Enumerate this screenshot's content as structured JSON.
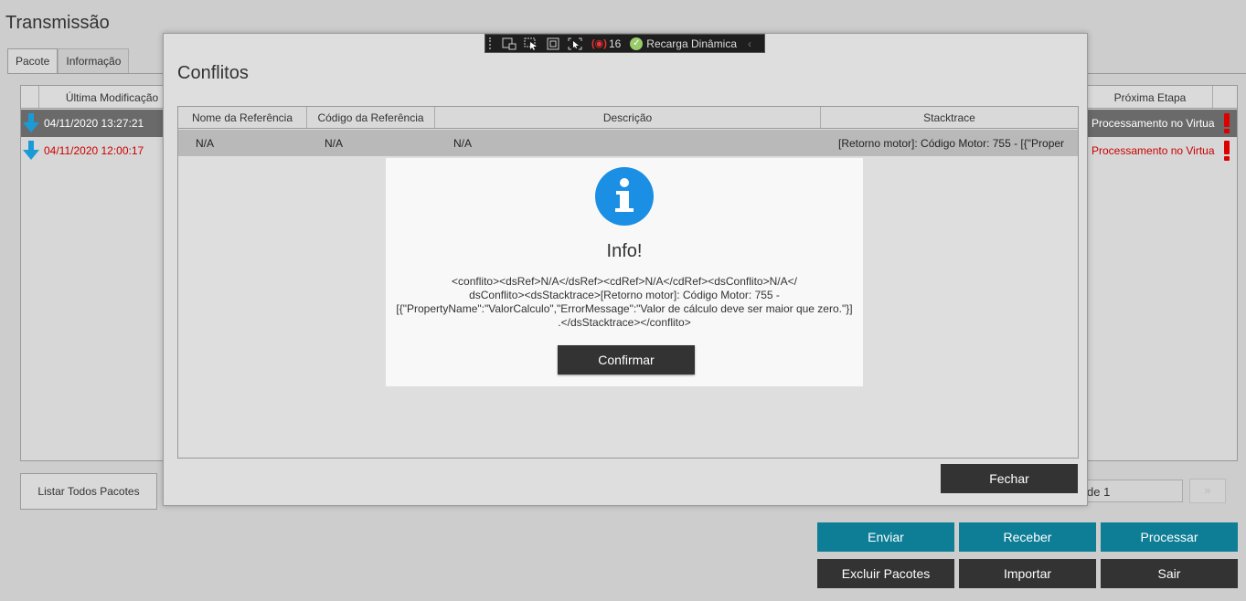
{
  "window": {
    "title": "Transmissão"
  },
  "tabs": [
    {
      "label": "Pacote",
      "active": true
    },
    {
      "label": "Informação",
      "active": false
    }
  ],
  "packages_table": {
    "columns": {
      "ultima_modificacao": "Última Modificação",
      "proxima_etapa": "Próxima Etapa"
    },
    "rows": [
      {
        "date": "04/11/2020 13:27:21",
        "etapa": "Processamento no Virtua",
        "selected": true
      },
      {
        "date": "04/11/2020 12:00:17",
        "etapa": "Processamento no Virtua",
        "selected": false
      }
    ]
  },
  "list_all_button": "Listar Todos Pacotes",
  "pagination": {
    "text": "de 1",
    "next": "»"
  },
  "actions": {
    "enviar": "Enviar",
    "receber": "Receber",
    "processar": "Processar",
    "excluir": "Excluir Pacotes",
    "importar": "Importar",
    "sair": "Sair"
  },
  "conflitos_dialog": {
    "title": "Conflitos",
    "columns": [
      "Nome da Referência",
      "Código da Referência",
      "Descrição",
      "Stacktrace"
    ],
    "row": {
      "nome": "N/A",
      "codigo": "N/A",
      "descricao": "N/A",
      "stacktrace": "[Retorno motor]: Código Motor: 755 - [{\"Proper"
    },
    "close_label": "Fechar"
  },
  "debug_toolbar": {
    "count": "16",
    "hot_reload_label": "Recarga Dinâmica",
    "collapse_glyph": "‹"
  },
  "info_modal": {
    "title": "Info!",
    "message_lines": [
      "<conflito><dsRef>N/A</dsRef><cdRef>N/A</cdRef><dsConflito>N/A</",
      "dsConflito><dsStacktrace>[Retorno motor]: Código Motor: 755 -",
      "[{\"PropertyName\":\"ValorCalculo\",\"ErrorMessage\":\"Valor de cálculo deve ser maior que zero.\"}]",
      ".</dsStacktrace></conflito>"
    ],
    "confirm_label": "Confirmar"
  },
  "colors": {
    "accent_blue": "#0d7e96",
    "dark_button": "#333333",
    "info_blue": "#1a8fe3",
    "error_red": "#cc0000",
    "arrow_blue": "#1a9bd6"
  }
}
